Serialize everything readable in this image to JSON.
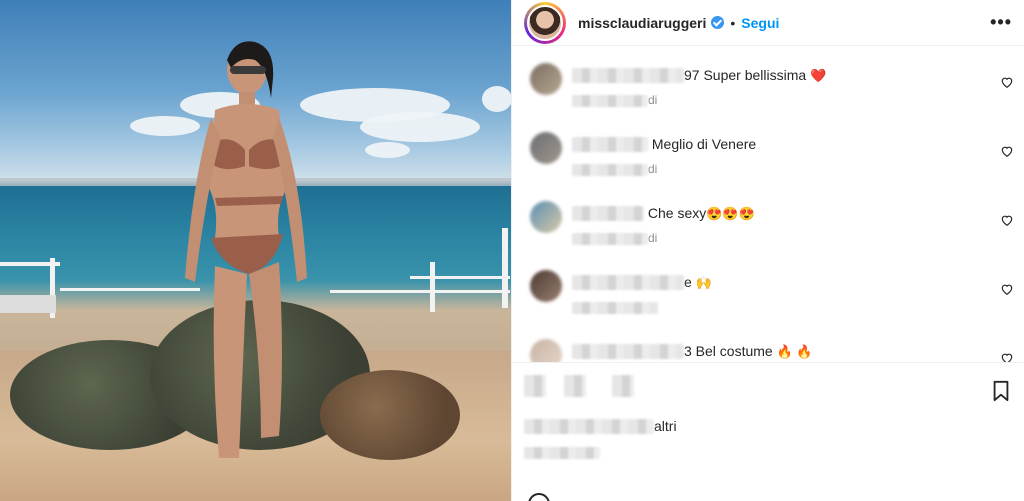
{
  "post": {
    "username": "missclaudiaruggeri",
    "follow_label": "Segui",
    "separator": "•",
    "more_label": "•••"
  },
  "comments": [
    {
      "suffix": "97 Super bellissima",
      "emoji": "❤️",
      "meta_suffix": "di"
    },
    {
      "suffix": "Meglio di Venere",
      "emoji": "",
      "meta_suffix": "di"
    },
    {
      "suffix": "Che sexy",
      "emoji": "😍😍😍",
      "meta_suffix": "di"
    },
    {
      "suffix": "e",
      "emoji": "🙌",
      "meta_suffix": ""
    },
    {
      "suffix": "3 Bel costume",
      "emoji": "🔥 🔥",
      "meta_suffix": ""
    }
  ],
  "footer": {
    "likes_suffix": "altri"
  },
  "colors": {
    "link": "#0095f6",
    "verified": "#3897f0",
    "text": "#262626",
    "meta": "#8e8e8e"
  },
  "icons": [
    "heart-icon",
    "bookmark-icon",
    "verified-icon",
    "more-options-icon"
  ]
}
